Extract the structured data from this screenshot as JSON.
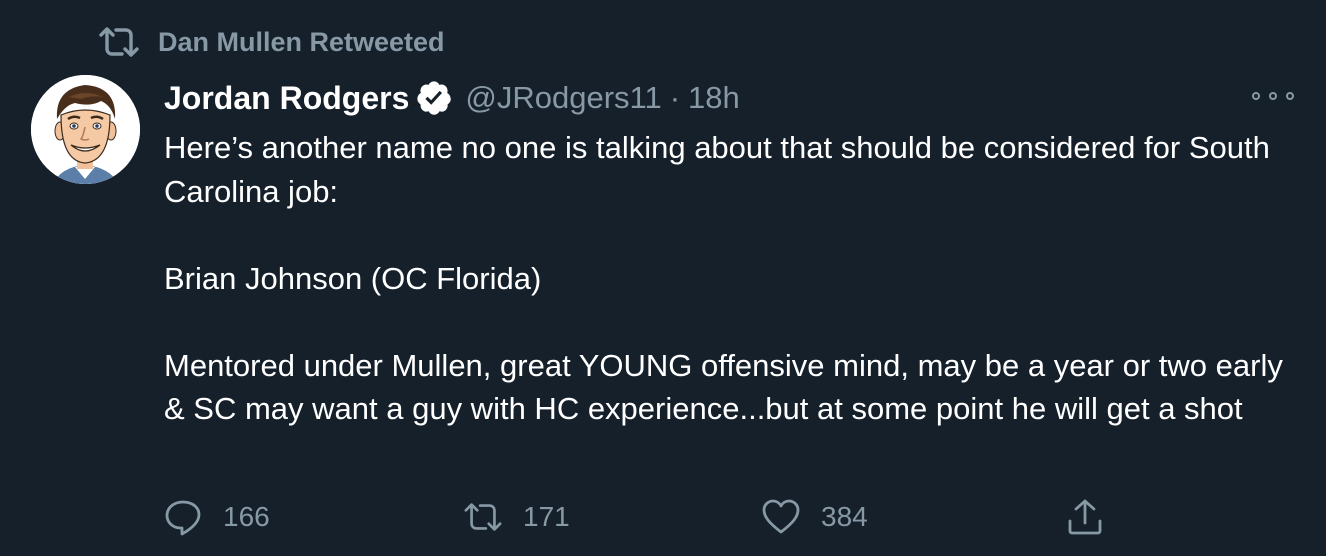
{
  "retweet_banner": {
    "text": "Dan Mullen Retweeted",
    "icon": "retweet-icon"
  },
  "tweet": {
    "author_name": "Jordan Rodgers",
    "verified_icon": "verified-badge-icon",
    "handle": "@JRodgers11",
    "separator": "·",
    "time": "18h",
    "avatar_icon": "avatar-cartoon-portrait",
    "paragraphs": [
      "Here’s another name no one is talking about that should be considered for South Carolina job:",
      "Brian Johnson (OC Florida)",
      "Mentored under Mullen, great YOUNG offensive mind, may be a year or two early & SC may want a guy with HC experience...but at some point he will get a shot"
    ]
  },
  "actions": {
    "reply": {
      "icon": "reply-icon",
      "count": "166"
    },
    "retweet": {
      "icon": "retweet-icon",
      "count": "171"
    },
    "like": {
      "icon": "heart-icon",
      "count": "384"
    },
    "share": {
      "icon": "share-icon"
    }
  },
  "colors": {
    "background": "#15202b",
    "text": "#ffffff",
    "secondary": "#8899a6",
    "verified": "#ffffff"
  }
}
